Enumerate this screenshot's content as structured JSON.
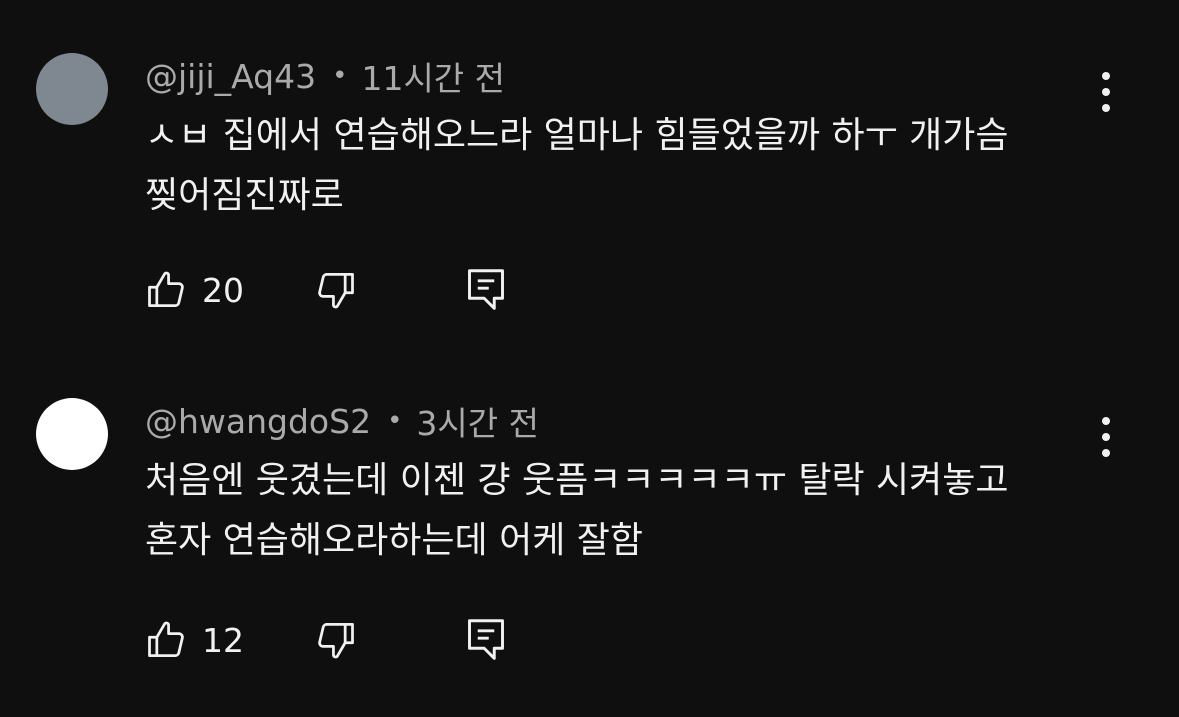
{
  "comments": [
    {
      "handle": "@jiji_Aq43",
      "separator": "•",
      "time": "11시간 전",
      "avatar_color": "#7f8790",
      "lines": [
        "ㅅㅂ 집에서 연습해오느라 얼마나 힘들었을까 하ㅜ 개가슴",
        "찢어짐진짜로"
      ],
      "like_count": "20",
      "icons": {
        "like": "thumbs-up-icon",
        "dislike": "thumbs-down-icon",
        "reply": "reply-comment-icon",
        "more": "more-vertical-icon"
      }
    },
    {
      "handle": "@hwangdoS2",
      "separator": "•",
      "time": "3시간 전",
      "avatar_color": "#ffffff",
      "lines": [
        "처음엔 웃겼는데 이젠 걍 웃픔ㅋㅋㅋㅋㅋㅠ 탈락 시켜놓고",
        "혼자 연습해오라하는데 어케 잘함"
      ],
      "like_count": "12",
      "icons": {
        "like": "thumbs-up-icon",
        "dislike": "thumbs-down-icon",
        "reply": "reply-comment-icon",
        "more": "more-vertical-icon"
      }
    }
  ],
  "colors": {
    "background": "#0f0f0f",
    "primary_text": "#f1f1f1",
    "secondary_text": "#aaaaaa"
  }
}
